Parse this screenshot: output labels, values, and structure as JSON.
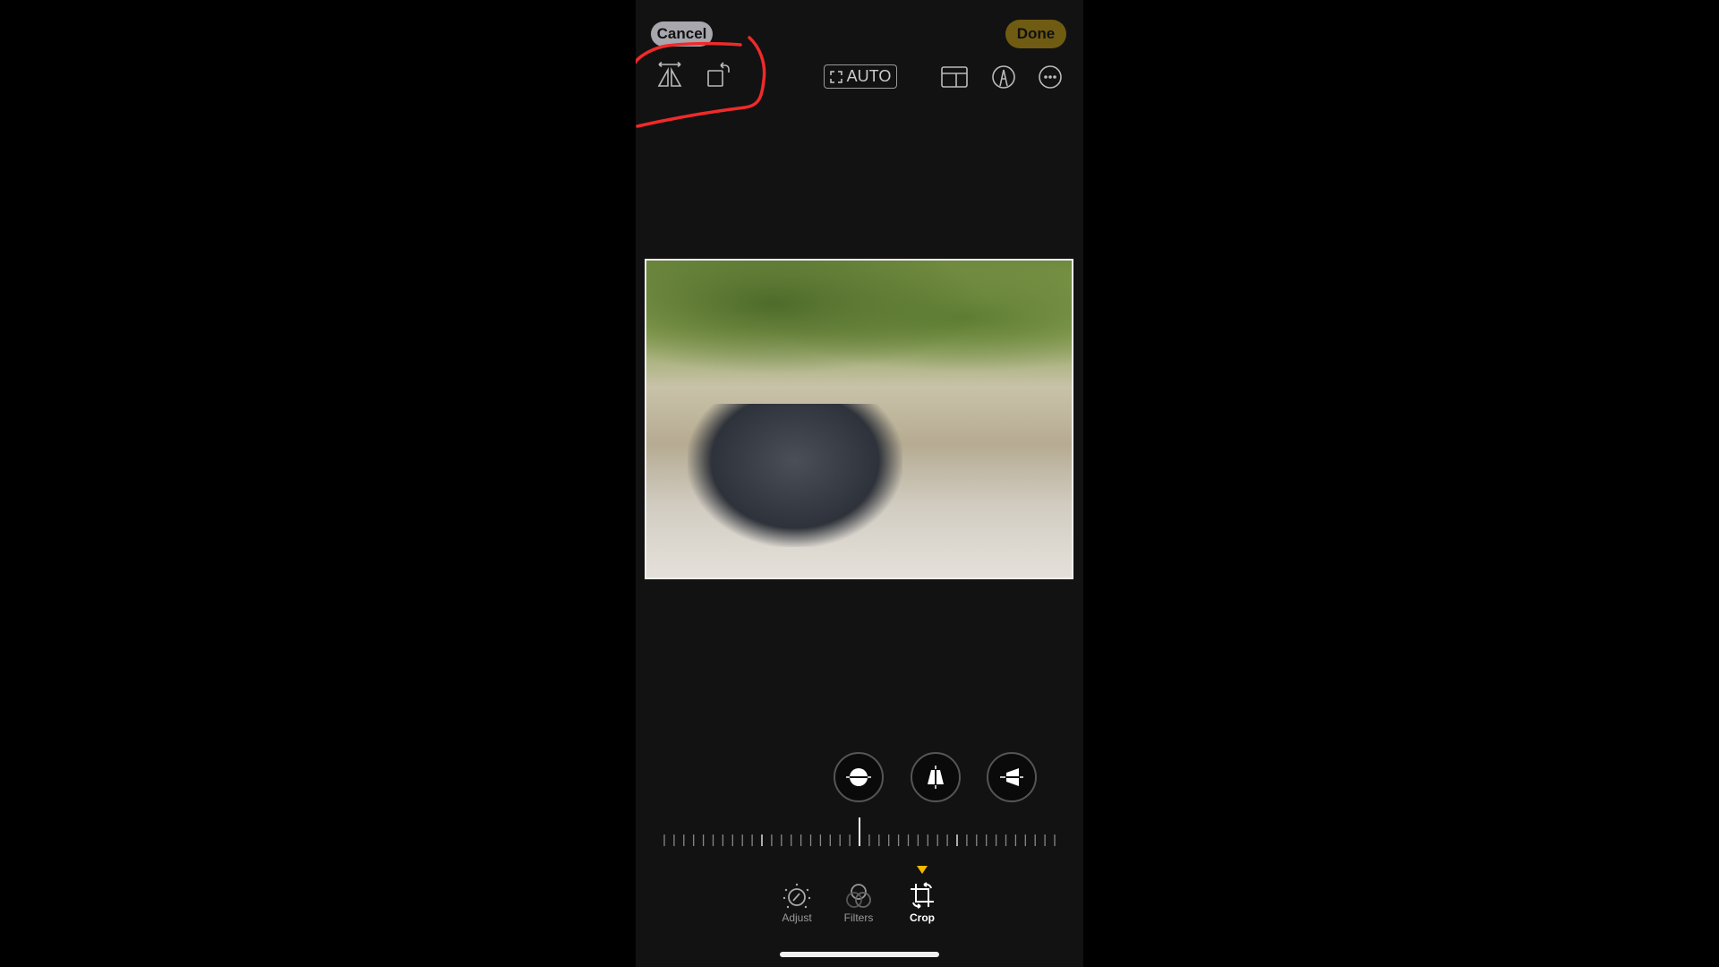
{
  "header": {
    "cancel_label": "Cancel",
    "done_label": "Done",
    "auto_label": "AUTO"
  },
  "icons": [
    "flip-horizontal-icon",
    "rotate-icon",
    "auto-straighten-icon",
    "aspect-ratio-icon",
    "markup-icon",
    "more-icon"
  ],
  "adjust_buttons": [
    "straighten",
    "vertical-perspective",
    "horizontal-perspective"
  ],
  "tabs": [
    {
      "label": "Adjust",
      "active": false
    },
    {
      "label": "Filters",
      "active": false
    },
    {
      "label": "Crop",
      "active": true
    }
  ],
  "colors": {
    "done": "#6f5c12",
    "cancel": "#a7a7ad",
    "active_indicator": "#f5b800",
    "annotation": "#f02a2a"
  }
}
